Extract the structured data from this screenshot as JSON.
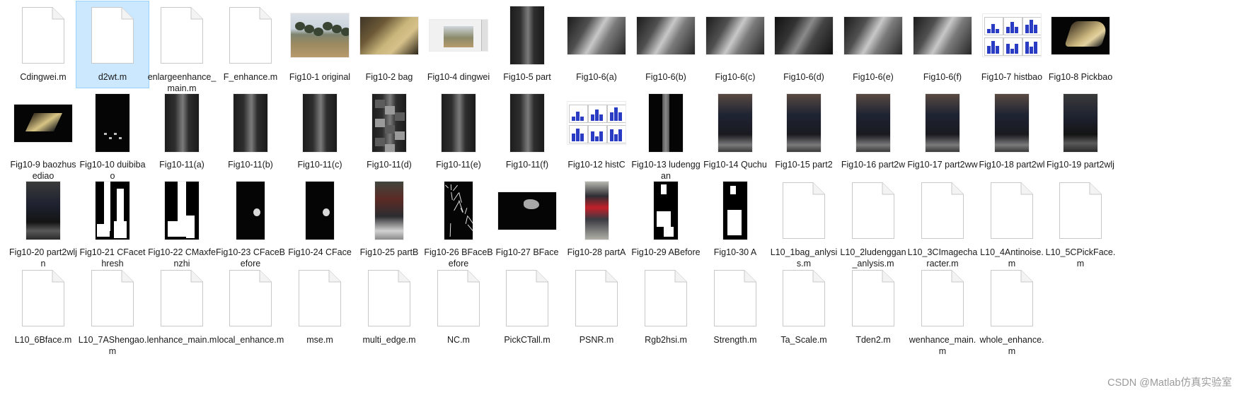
{
  "window": {
    "view": "Large icons"
  },
  "files": [
    {
      "name": "Cdingwei.m",
      "type": "m"
    },
    {
      "name": "d2wt.m",
      "type": "m",
      "selected": true
    },
    {
      "name": "enlargeenhance_main.m",
      "type": "m"
    },
    {
      "name": "F_enhance.m",
      "type": "m"
    },
    {
      "name": "Fig10-1 original",
      "type": "img",
      "kind": "scene"
    },
    {
      "name": "Fig10-2 bag",
      "type": "img",
      "kind": "bag"
    },
    {
      "name": "Fig10-4 dingwei",
      "type": "img",
      "kind": "dingwei"
    },
    {
      "name": "Fig10-5 part",
      "type": "img",
      "kind": "part"
    },
    {
      "name": "Fig10-6(a)",
      "type": "img",
      "kind": "gray"
    },
    {
      "name": "Fig10-6(b)",
      "type": "img",
      "kind": "gray"
    },
    {
      "name": "Fig10-6(c)",
      "type": "img",
      "kind": "gray"
    },
    {
      "name": "Fig10-6(d)",
      "type": "img",
      "kind": "gray2"
    },
    {
      "name": "Fig10-6(e)",
      "type": "img",
      "kind": "gray"
    },
    {
      "name": "Fig10-6(f)",
      "type": "img",
      "kind": "gray"
    },
    {
      "name": "Fig10-7 histbao",
      "type": "img",
      "kind": "hist"
    },
    {
      "name": "Fig10-8 Pickbao",
      "type": "img",
      "kind": "pickbao"
    },
    {
      "name": "Fig10-9 baozhusediao",
      "type": "img",
      "kind": "baozhu"
    },
    {
      "name": "Fig10-10 duibibao",
      "type": "img",
      "kind": "dark"
    },
    {
      "name": "Fig10-11(a)",
      "type": "img",
      "kind": "pole"
    },
    {
      "name": "Fig10-11(b)",
      "type": "img",
      "kind": "pole"
    },
    {
      "name": "Fig10-11(c)",
      "type": "img",
      "kind": "pole"
    },
    {
      "name": "Fig10-11(d)",
      "type": "img",
      "kind": "block"
    },
    {
      "name": "Fig10-11(e)",
      "type": "img",
      "kind": "pole"
    },
    {
      "name": "Fig10-11(f)",
      "type": "img",
      "kind": "pole"
    },
    {
      "name": "Fig10-12 histC",
      "type": "img",
      "kind": "hist"
    },
    {
      "name": "Fig10-13 ludenggan",
      "type": "img",
      "kind": "lamp"
    },
    {
      "name": "Fig10-14 Quchu",
      "type": "img",
      "kind": "personc"
    },
    {
      "name": "Fig10-15 part2",
      "type": "img",
      "kind": "personc"
    },
    {
      "name": "Fig10-16 part2w",
      "type": "img",
      "kind": "personc"
    },
    {
      "name": "Fig10-17 part2ww",
      "type": "img",
      "kind": "personc"
    },
    {
      "name": "Fig10-18 part2wl",
      "type": "img",
      "kind": "personc"
    },
    {
      "name": "Fig10-19 part2wlj",
      "type": "img",
      "kind": "person"
    },
    {
      "name": "Fig10-20 part2wljn",
      "type": "img",
      "kind": "person"
    },
    {
      "name": "Fig10-21 CFacethresh",
      "type": "img",
      "kind": "bw1"
    },
    {
      "name": "Fig10-22 CMaxfenzhi",
      "type": "img",
      "kind": "bw2"
    },
    {
      "name": "Fig10-23 CFaceBefore",
      "type": "img",
      "kind": "face"
    },
    {
      "name": "Fig10-24 CFace",
      "type": "img",
      "kind": "face"
    },
    {
      "name": "Fig10-25 partB",
      "type": "img",
      "kind": "personb"
    },
    {
      "name": "Fig10-26 BFaceBefore",
      "type": "img",
      "kind": "edge"
    },
    {
      "name": "Fig10-27 BFace",
      "type": "img",
      "kind": "bface"
    },
    {
      "name": "Fig10-28 partA",
      "type": "img",
      "kind": "persona"
    },
    {
      "name": "Fig10-29 ABefore",
      "type": "img",
      "kind": "bw3"
    },
    {
      "name": "Fig10-30 A",
      "type": "img",
      "kind": "bw4"
    },
    {
      "name": "L10_1bag_anlysis.m",
      "type": "m"
    },
    {
      "name": "L10_2ludenggan_anlysis.m",
      "type": "m"
    },
    {
      "name": "L10_3CImagecharacter.m",
      "type": "m"
    },
    {
      "name": "L10_4Antinoise.m",
      "type": "m"
    },
    {
      "name": "L10_5CPickFace.m",
      "type": "m"
    },
    {
      "name": "L10_6Bface.m",
      "type": "m"
    },
    {
      "name": "L10_7AShengao.m",
      "type": "m"
    },
    {
      "name": "lenhance_main.m",
      "type": "m"
    },
    {
      "name": "local_enhance.m",
      "type": "m"
    },
    {
      "name": "mse.m",
      "type": "m"
    },
    {
      "name": "multi_edge.m",
      "type": "m"
    },
    {
      "name": "NC.m",
      "type": "m"
    },
    {
      "name": "PickCTall.m",
      "type": "m"
    },
    {
      "name": "PSNR.m",
      "type": "m"
    },
    {
      "name": "Rgb2hsi.m",
      "type": "m"
    },
    {
      "name": "Strength.m",
      "type": "m"
    },
    {
      "name": "Ta_Scale.m",
      "type": "m"
    },
    {
      "name": "Tden2.m",
      "type": "m"
    },
    {
      "name": "wenhance_main.m",
      "type": "m"
    },
    {
      "name": "whole_enhance.m",
      "type": "m"
    }
  ],
  "watermark": "CSDN @Matlab仿真实验室",
  "colors": {
    "selection_bg": "#cce8ff",
    "selection_border": "#99d1ff"
  }
}
